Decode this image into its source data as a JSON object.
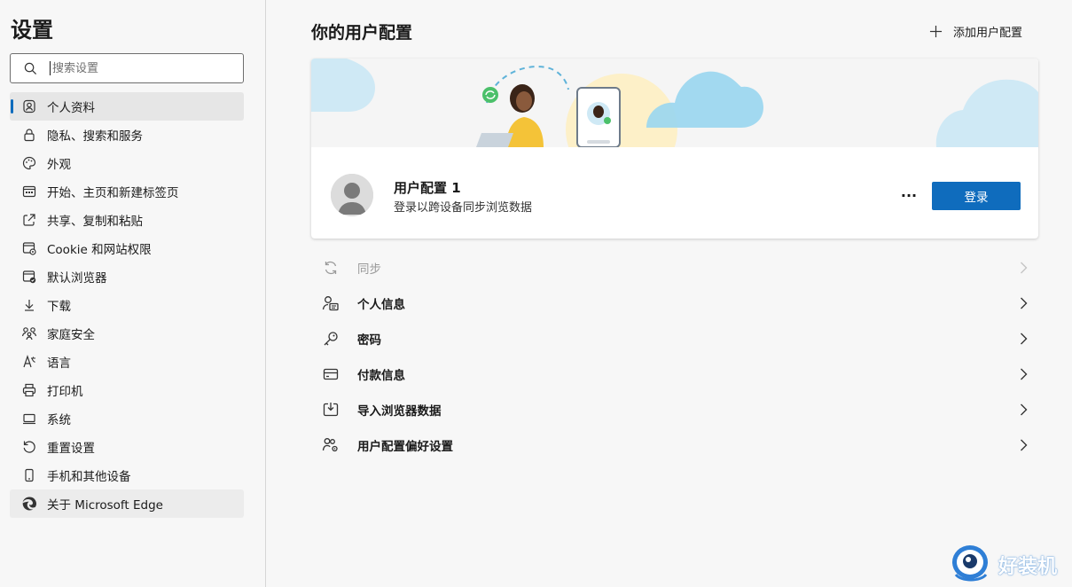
{
  "sidebar": {
    "title": "设置",
    "search": {
      "placeholder": "搜索设置",
      "value": ""
    },
    "items": [
      {
        "label": "个人资料",
        "icon": "profile-icon",
        "active": true
      },
      {
        "label": "隐私、搜索和服务",
        "icon": "lock-icon"
      },
      {
        "label": "外观",
        "icon": "palette-icon"
      },
      {
        "label": "开始、主页和新建标签页",
        "icon": "start-page-icon"
      },
      {
        "label": "共享、复制和粘贴",
        "icon": "share-icon"
      },
      {
        "label": "Cookie 和网站权限",
        "icon": "site-permissions-icon"
      },
      {
        "label": "默认浏览器",
        "icon": "default-browser-icon"
      },
      {
        "label": "下载",
        "icon": "download-icon"
      },
      {
        "label": "家庭安全",
        "icon": "family-icon"
      },
      {
        "label": "语言",
        "icon": "language-icon"
      },
      {
        "label": "打印机",
        "icon": "printer-icon"
      },
      {
        "label": "系统",
        "icon": "system-icon"
      },
      {
        "label": "重置设置",
        "icon": "reset-icon"
      },
      {
        "label": "手机和其他设备",
        "icon": "phone-icon"
      },
      {
        "label": "关于 Microsoft Edge",
        "icon": "edge-icon",
        "hover": true
      }
    ]
  },
  "main": {
    "title": "你的用户配置",
    "add_profile_label": "添加用户配置",
    "profile": {
      "name": "用户配置 1",
      "subtitle": "登录以跨设备同步浏览数据",
      "more_label": "···",
      "signin_label": "登录"
    },
    "rows": [
      {
        "label": "同步",
        "icon": "sync-icon",
        "disabled": true
      },
      {
        "label": "个人信息",
        "icon": "personal-info-icon"
      },
      {
        "label": "密码",
        "icon": "key-icon"
      },
      {
        "label": "付款信息",
        "icon": "card-icon"
      },
      {
        "label": "导入浏览器数据",
        "icon": "import-icon"
      },
      {
        "label": "用户配置偏好设置",
        "icon": "profile-prefs-icon"
      }
    ]
  },
  "watermark": {
    "text": "好装机"
  },
  "colors": {
    "accent": "#0f6cbd",
    "sidebar_bg": "#f7f7f7",
    "card_bg": "#ffffff"
  }
}
